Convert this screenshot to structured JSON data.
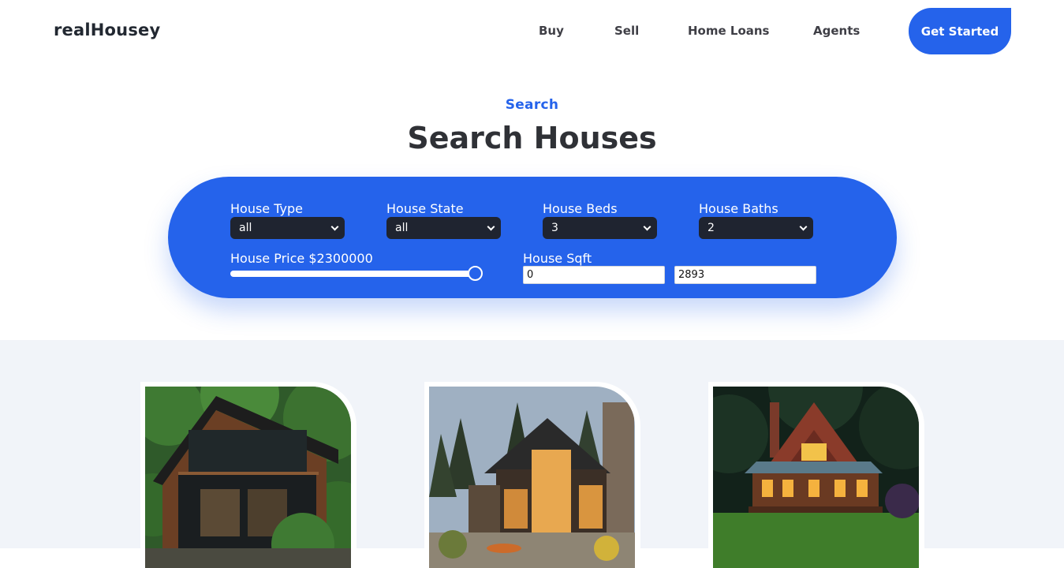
{
  "brand": {
    "logo": "realHousey"
  },
  "nav": {
    "buy": "Buy",
    "sell": "Sell",
    "home_loans": "Home Loans",
    "agents": "Agents",
    "cta": "Get Started"
  },
  "search_section": {
    "kicker": "Search",
    "title": "Search Houses"
  },
  "filters": {
    "house_type": {
      "label": "House Type",
      "value": "all"
    },
    "house_state": {
      "label": "House State",
      "value": "all"
    },
    "house_beds": {
      "label": "House Beds",
      "value": "3"
    },
    "house_baths": {
      "label": "House Baths",
      "value": "2"
    },
    "house_price": {
      "label": "House Price $2300000",
      "slider_fraction": 1.0
    },
    "house_sqft": {
      "label": "House Sqft",
      "min_value": "0",
      "max_value": "2893"
    }
  },
  "listings": [
    {
      "photo_icon": "modern-cabin-photo"
    },
    {
      "photo_icon": "mountain-lodge-photo"
    },
    {
      "photo_icon": "log-cabin-photo"
    }
  ],
  "colors": {
    "accent": "#2563eb",
    "select_bg": "#1f2430",
    "listings_bg": "#f1f4f9"
  }
}
